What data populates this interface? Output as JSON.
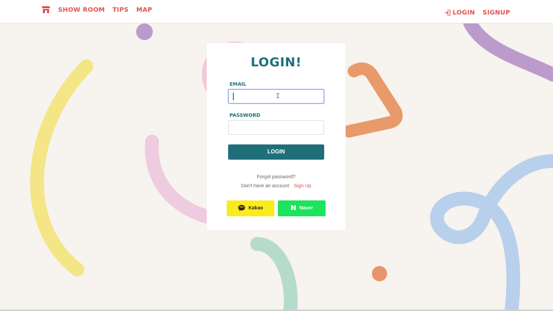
{
  "header": {
    "nav_left": [
      "SHOW ROOM",
      "TIPS",
      "MAP"
    ],
    "nav_right": {
      "login": "LOGIN",
      "signup": "SIGNUP"
    },
    "brand_color": "#e35050",
    "icons": {
      "home": "store-icon",
      "login": "login-arrow-icon"
    }
  },
  "login_card": {
    "title": "LOGIN!",
    "email_label": "EMAIL",
    "email_value": "",
    "password_label": "PASSWORD",
    "password_value": "",
    "submit_label": "LOGIN",
    "forgot_text": "Forgot password?",
    "no_account_text": "Don't have an account",
    "signup_text": "Sign Up",
    "kakao_label": "Kakao",
    "naver_label": "Naver",
    "accent_color": "#1f6f7a",
    "kakao_color": "#f9ec1e",
    "naver_color": "#1ee35c"
  }
}
